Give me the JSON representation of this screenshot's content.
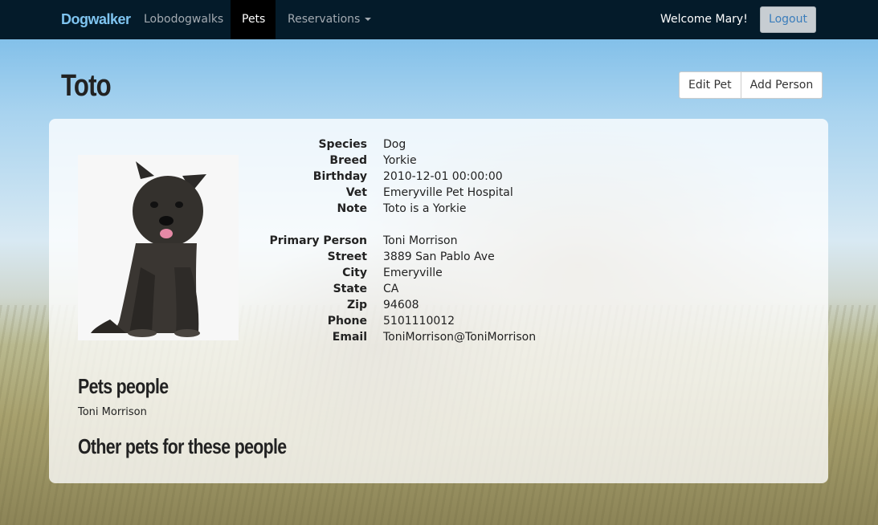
{
  "navbar": {
    "brand": "Dogwalker",
    "items": [
      {
        "label": "Lobodogwalks"
      },
      {
        "label": "Pets"
      },
      {
        "label": "Reservations"
      }
    ],
    "welcome": "Welcome Mary!",
    "logout": "Logout"
  },
  "page": {
    "title": "Toto",
    "buttons": {
      "edit_pet": "Edit Pet",
      "add_person": "Add Person"
    }
  },
  "pet": {
    "fields": [
      {
        "label": "Species",
        "value": "Dog"
      },
      {
        "label": "Breed",
        "value": "Yorkie"
      },
      {
        "label": "Birthday",
        "value": "2010-12-01 00:00:00"
      },
      {
        "label": "Vet",
        "value": "Emeryville Pet Hospital"
      },
      {
        "label": "Note",
        "value": "Toto is a Yorkie"
      }
    ]
  },
  "person": {
    "fields": [
      {
        "label": "Primary Person",
        "value": "Toni Morrison"
      },
      {
        "label": "Street",
        "value": "3889 San Pablo Ave"
      },
      {
        "label": "City",
        "value": "Emeryville"
      },
      {
        "label": "State",
        "value": "CA"
      },
      {
        "label": "Zip",
        "value": "94608"
      },
      {
        "label": "Phone",
        "value": "5101110012"
      },
      {
        "label": "Email",
        "value": "ToniMorrison@ToniMorrison"
      }
    ]
  },
  "sections": {
    "pets_people_heading": "Pets people",
    "pets_people": [
      "Toni Morrison"
    ],
    "other_pets_heading": "Other pets for these people"
  },
  "colors": {
    "navbar": "#041b2a",
    "brand": "#7fc4f0",
    "link": "#3b7dbb"
  }
}
